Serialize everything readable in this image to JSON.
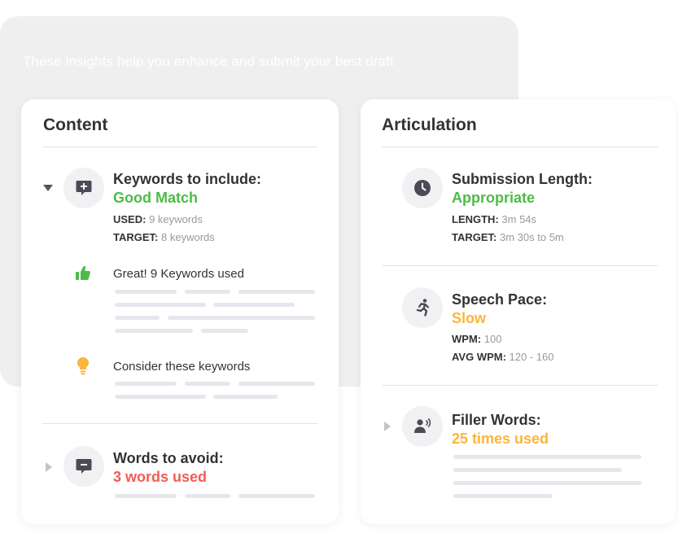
{
  "backdrop": {
    "text": "These insights help you enhance and submit your best draft"
  },
  "colors": {
    "green": "#4cbb47",
    "red": "#f25c54",
    "orange": "#fbb53c",
    "icon_gray": "#4b4b57"
  },
  "content": {
    "title": "Content",
    "keywords": {
      "title": "Keywords to include:",
      "status": "Good Match",
      "used_label": "USED:",
      "used_value": "9 keywords",
      "target_label": "TARGET:",
      "target_value": "8 keywords",
      "great_text": "Great! 9 Keywords used",
      "consider_text": "Consider these keywords"
    },
    "avoid": {
      "title": "Words to avoid:",
      "status": "3 words used"
    }
  },
  "articulation": {
    "title": "Articulation",
    "length": {
      "title": "Submission Length:",
      "status": "Appropriate",
      "length_label": "LENGTH:",
      "length_value": "3m 54s",
      "target_label": "TARGET:",
      "target_value": "3m 30s to 5m"
    },
    "pace": {
      "title": "Speech Pace:",
      "status": "Slow",
      "wpm_label": "WPM:",
      "wpm_value": "100",
      "avg_label": "AVG WPM:",
      "avg_value": "120 - 160"
    },
    "filler": {
      "title": "Filler Words:",
      "status": "25 times used"
    }
  },
  "icons": {
    "keywords": "chat-plus-icon",
    "avoid": "chat-minus-icon",
    "thumbs": "thumbs-up-icon",
    "bulb": "lightbulb-icon",
    "clock": "clock-icon",
    "runner": "running-person-icon",
    "speaker": "speaking-person-icon"
  }
}
